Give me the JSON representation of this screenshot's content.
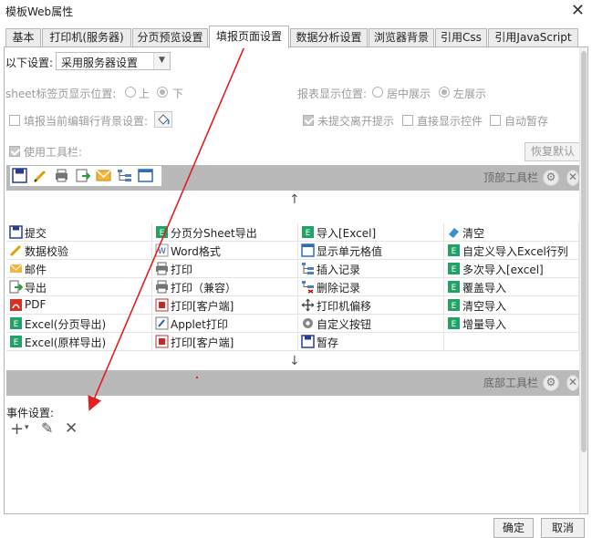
{
  "window": {
    "title": "模板Web属性",
    "close_glyph": "✕"
  },
  "tabs": [
    {
      "label": "基本"
    },
    {
      "label": "打印机(服务器)"
    },
    {
      "label": "分页预览设置"
    },
    {
      "label": "填报页面设置"
    },
    {
      "label": "数据分析设置"
    },
    {
      "label": "浏览器背景"
    },
    {
      "label": "引用Css"
    },
    {
      "label": "引用JavaScript"
    }
  ],
  "settings": {
    "following_label": "以下设置:",
    "mode_value": "采用服务器设置",
    "sheet_pos_label": "sheet标签页显示位置:",
    "sheet_pos_options": [
      "上",
      "下"
    ],
    "report_pos_label": "报表显示位置:",
    "report_pos_options": [
      "居中展示",
      "左展示"
    ],
    "fill_bg_label": "填报当前编辑行背景设置:",
    "unsubmitted_label": "未提交离开提示",
    "show_control_label": "直接显示控件",
    "autosave_label": "自动暂存",
    "use_toolbar_label": "使用工具栏:",
    "restore_label": "恢复默认"
  },
  "toolbar": {
    "top_label": "顶部工具栏",
    "bottom_label": "底部工具栏",
    "up_arrow": "↑",
    "down_arrow": "↓"
  },
  "grid": [
    [
      "提交",
      "分页分Sheet导出",
      "导入[Excel]",
      "清空"
    ],
    [
      "数据校验",
      "Word格式",
      "显示单元格值",
      "自定义导入Excel行列"
    ],
    [
      "邮件",
      "打印",
      "插入记录",
      "多次导入[excel]"
    ],
    [
      "导出",
      "打印（兼容）",
      "删除记录",
      "覆盖导入"
    ],
    [
      "PDF",
      "打印[客户端]",
      "打印机偏移",
      "清空导入"
    ],
    [
      "Excel(分页导出)",
      "Applet打印",
      "自定义按钮",
      "增量导入"
    ],
    [
      "Excel(原样导出)",
      "打印[客户端]",
      "暂存",
      ""
    ]
  ],
  "events": {
    "label": "事件设置:"
  },
  "footer": {
    "ok": "确定",
    "cancel": "取消"
  },
  "colors": {
    "accent": "#e02020",
    "toolbar_bg": "#b9b9b9"
  }
}
